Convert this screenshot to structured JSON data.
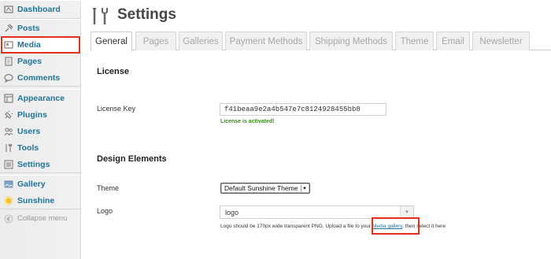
{
  "sidebar": {
    "items": [
      {
        "label": "Dashboard",
        "icon": "dashboard-icon"
      },
      {
        "label": "Posts",
        "icon": "pin-icon"
      },
      {
        "label": "Media",
        "icon": "media-icon"
      },
      {
        "label": "Pages",
        "icon": "page-icon"
      },
      {
        "label": "Comments",
        "icon": "comment-icon"
      },
      {
        "label": "Appearance",
        "icon": "appearance-icon"
      },
      {
        "label": "Plugins",
        "icon": "plugin-icon"
      },
      {
        "label": "Users",
        "icon": "users-icon"
      },
      {
        "label": "Tools",
        "icon": "tools-icon"
      },
      {
        "label": "Settings",
        "icon": "settings-icon"
      },
      {
        "label": "Gallery",
        "icon": "gallery-icon"
      },
      {
        "label": "Sunshine",
        "icon": "sun-icon"
      }
    ],
    "collapse_label": "Collapse menu"
  },
  "header": {
    "title": "Settings"
  },
  "tabs": [
    {
      "label": "General",
      "active": true
    },
    {
      "label": "Pages"
    },
    {
      "label": "Galleries"
    },
    {
      "label": "Payment Methods"
    },
    {
      "label": "Shipping Methods"
    },
    {
      "label": "Theme"
    },
    {
      "label": "Email"
    },
    {
      "label": "Newsletter"
    }
  ],
  "license": {
    "section_title": "License",
    "key_label": "License Key",
    "key_value": "f41beaa9e2a4b547e7c8124928455bb8",
    "status": "License is activated!"
  },
  "design": {
    "section_title": "Design Elements",
    "theme_label": "Theme",
    "theme_value": "Default Sunshine Theme",
    "logo_label": "Logo",
    "logo_value": "logo",
    "logo_help_before": "Logo should be 170px wide transparent PNG. Upload a file to your ",
    "logo_help_link": "Media gallery",
    "logo_help_after": ", then select it here"
  },
  "colors": {
    "accent": "#21759b",
    "highlight": "#e3311d",
    "success": "#3a8a1f"
  }
}
